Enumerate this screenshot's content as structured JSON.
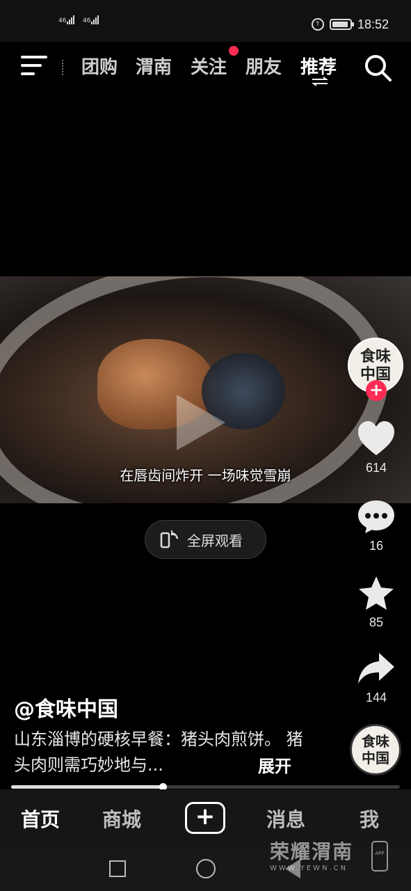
{
  "status_bar": {
    "signal1": "46",
    "signal2": "46",
    "time": "18:52"
  },
  "top_nav": {
    "tabs": [
      {
        "label": "团购"
      },
      {
        "label": "渭南"
      },
      {
        "label": "关注"
      },
      {
        "label": "朋友"
      },
      {
        "label": "推荐"
      }
    ],
    "active_tab": "推荐",
    "icons": [
      "menu-icon",
      "search-icon",
      "swap-icon"
    ]
  },
  "video": {
    "subtitle": "在唇齿间炸开 一场味觉雪崩",
    "fullscreen_label": "全屏观看"
  },
  "rail": {
    "avatar_text": "食味\n中国",
    "likes": "614",
    "comments": "16",
    "favorites": "85",
    "shares": "144",
    "disc_text": "食味\n中国"
  },
  "caption": {
    "author": "@食味中国",
    "description": "山东淄博的硬核早餐：猪头肉煎饼。 猪头肉则需巧妙地与...",
    "expand": "展开"
  },
  "progress": {
    "value": 0.39
  },
  "tab_bar": {
    "items": [
      {
        "label": "首页"
      },
      {
        "label": "商城"
      },
      {
        "label": "+"
      },
      {
        "label": "消息"
      },
      {
        "label": "我"
      }
    ]
  },
  "watermark": {
    "title": "荣耀渭南",
    "url": "WWW.YEWN.CN",
    "app": "APP"
  },
  "colors": {
    "accent": "#fe2c55",
    "background": "#000000"
  }
}
